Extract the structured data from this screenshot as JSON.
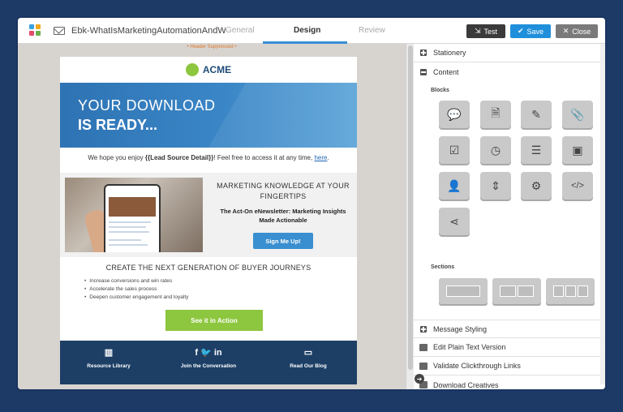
{
  "topbar": {
    "doc_title": "Ebk-WhatIsMarketingAutomationAndW...",
    "tabs": [
      {
        "label": "General"
      },
      {
        "label": "Design"
      },
      {
        "label": "Review"
      }
    ],
    "buttons": {
      "test": "Test",
      "save": "Save",
      "close": "Close"
    }
  },
  "canvas": {
    "header_suppressed": "• Header Suppressed •",
    "brand": "ACME",
    "hero": {
      "line1": "YOUR DOWNLOAD",
      "line2": "IS READY..."
    },
    "intro": {
      "pre": "We hope you enjoy ",
      "token": "{{Lead Source Detail}}",
      "mid": "! Feel free to access it at any time, ",
      "link": "here",
      "post": "."
    },
    "promo": {
      "title": "MARKETING KNOWLEDGE AT YOUR FINGERTIPS",
      "subtitle": "The Act-On eNewsletter: Marketing Insights Made Actionable",
      "button": "Sign Me Up!"
    },
    "journeys_title": "CREATE THE NEXT GENERATION OF BUYER JOURNEYS",
    "bullets": [
      "Increase conversions and win rates",
      "Accelerate the sales process",
      "Deepen customer engagement and loyalty"
    ],
    "cta": "See it in Action",
    "footer": [
      {
        "icon": "library-icon",
        "label": "Resource Library"
      },
      {
        "icon": "social-icons",
        "label": "Join the Conversation"
      },
      {
        "icon": "chat-icon",
        "label": "Read Our Blog"
      }
    ]
  },
  "panel": {
    "stationery": "Stationery",
    "content": "Content",
    "blocks_label": "Blocks",
    "sections_label": "Sections",
    "blocks": [
      {
        "icon": "speech-bubble-icon",
        "glyph": "💬"
      },
      {
        "icon": "document-icon",
        "glyph": "🗎"
      },
      {
        "icon": "pencil-icon",
        "glyph": "✎"
      },
      {
        "icon": "paperclip-icon",
        "glyph": "📎"
      },
      {
        "icon": "checkbox-icon",
        "glyph": "☑"
      },
      {
        "icon": "clock-icon",
        "glyph": "◷"
      },
      {
        "icon": "list-icon",
        "glyph": "☰"
      },
      {
        "icon": "image-icon",
        "glyph": "▣"
      },
      {
        "icon": "person-icon",
        "glyph": "👤"
      },
      {
        "icon": "spacer-icon",
        "glyph": "⇕"
      },
      {
        "icon": "gears-icon",
        "glyph": "⚙"
      },
      {
        "icon": "code-icon",
        "glyph": "</>"
      },
      {
        "icon": "share-icon",
        "glyph": "⋖"
      }
    ],
    "message_styling": "Message Styling",
    "plain_text": "Edit Plain Text Version",
    "validate": "Validate Clickthrough Links",
    "download": "Download Creatives"
  }
}
